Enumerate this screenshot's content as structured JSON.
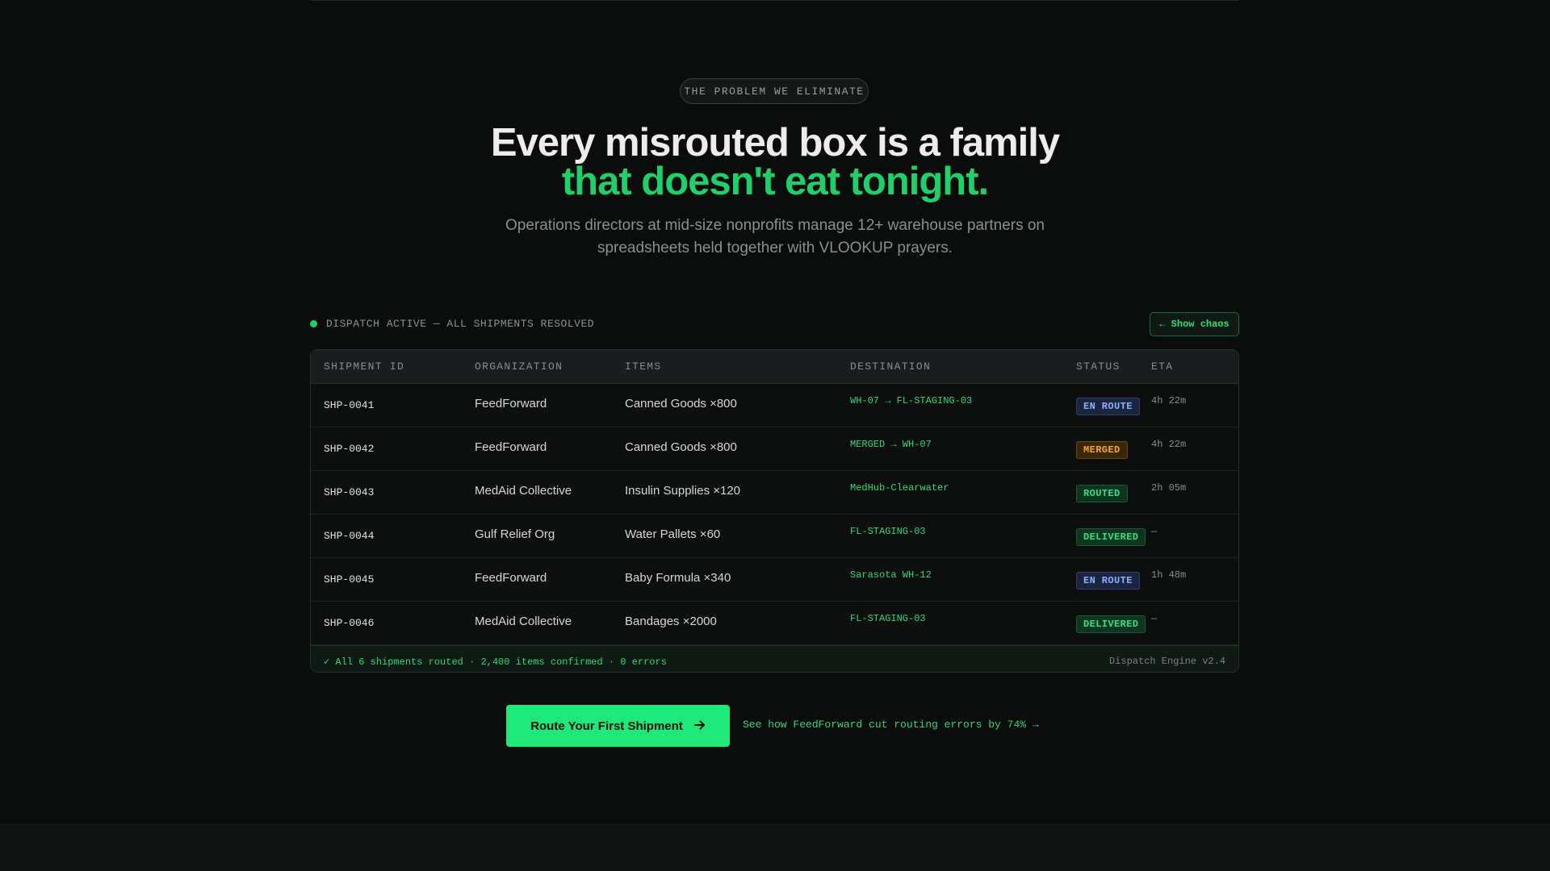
{
  "eyebrow": "THE PROBLEM WE ELIMINATE",
  "headline": {
    "line1": "Every misrouted box is a family",
    "line2": "that doesn't eat tonight."
  },
  "subtext": "Operations directors at mid-size nonprofits manage 12+ warehouse partners on spreadsheets held together with VLOOKUP prayers.",
  "dispatch": {
    "status": "DISPATCH ACTIVE — ALL SHIPMENTS RESOLVED",
    "toggle_label": "← Show chaos"
  },
  "table": {
    "columns": [
      "SHIPMENT ID",
      "ORGANIZATION",
      "ITEMS",
      "DESTINATION",
      "STATUS",
      "ETA"
    ],
    "rows": [
      {
        "id": "SHP-0041",
        "org": "FeedForward",
        "items": "Canned Goods ×800",
        "dest": "WH-07 → FL-STAGING-03",
        "status": "EN ROUTE",
        "status_kind": "enroute",
        "eta": "4h 22m"
      },
      {
        "id": "SHP-0042",
        "org": "FeedForward",
        "items": "Canned Goods ×800",
        "dest": "MERGED → WH-07",
        "status": "MERGED",
        "status_kind": "merged",
        "eta": "4h 22m"
      },
      {
        "id": "SHP-0043",
        "org": "MedAid Collective",
        "items": "Insulin Supplies ×120",
        "dest": "MedHub-Clearwater",
        "status": "ROUTED",
        "status_kind": "routed",
        "eta": "2h 05m"
      },
      {
        "id": "SHP-0044",
        "org": "Gulf Relief Org",
        "items": "Water Pallets ×60",
        "dest": "FL-STAGING-03",
        "status": "DELIVERED",
        "status_kind": "delivered",
        "eta": "—"
      },
      {
        "id": "SHP-0045",
        "org": "FeedForward",
        "items": "Baby Formula ×340",
        "dest": "Sarasota WH-12",
        "status": "EN ROUTE",
        "status_kind": "enroute",
        "eta": "1h 48m"
      },
      {
        "id": "SHP-0046",
        "org": "MedAid Collective",
        "items": "Bandages ×2000",
        "dest": "FL-STAGING-03",
        "status": "DELIVERED",
        "status_kind": "delivered",
        "eta": "—"
      }
    ],
    "footer_summary": "✓ All 6 shipments routed · 2,400 items confirmed · 0 errors",
    "footer_engine": "Dispatch Engine v2.4"
  },
  "cta": {
    "primary_label": "Route Your First Shipment",
    "primary_icon": "arrow-right-icon",
    "secondary_label": "See how FeedForward cut routing errors by 74% →"
  },
  "colors": {
    "accent": "#1fd06a",
    "background": "#0b0c0c",
    "enroute": "#8cb0ff",
    "merged": "#f5a623"
  }
}
